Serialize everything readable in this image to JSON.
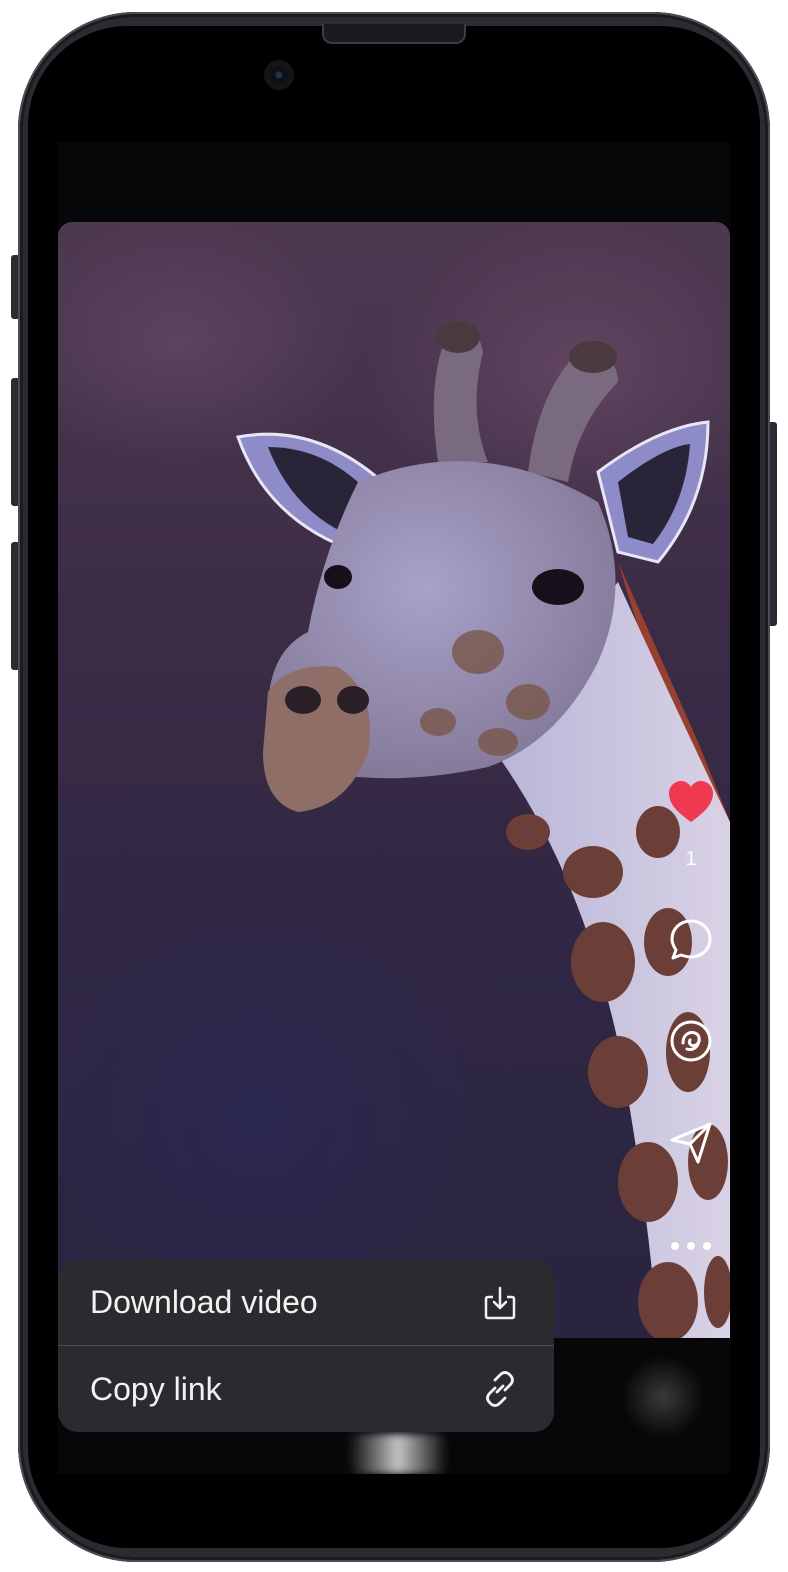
{
  "post": {
    "like_count": "1"
  },
  "actions": {
    "like_icon": "heart-icon",
    "comment_icon": "comment-icon",
    "remix_icon": "remix-icon",
    "share_icon": "send-icon",
    "more_icon": "more-icon",
    "like_color": "#f0394f"
  },
  "context_menu": {
    "items": [
      {
        "label": "Download video",
        "icon": "download-icon"
      },
      {
        "label": "Copy link",
        "icon": "link-icon"
      }
    ]
  }
}
